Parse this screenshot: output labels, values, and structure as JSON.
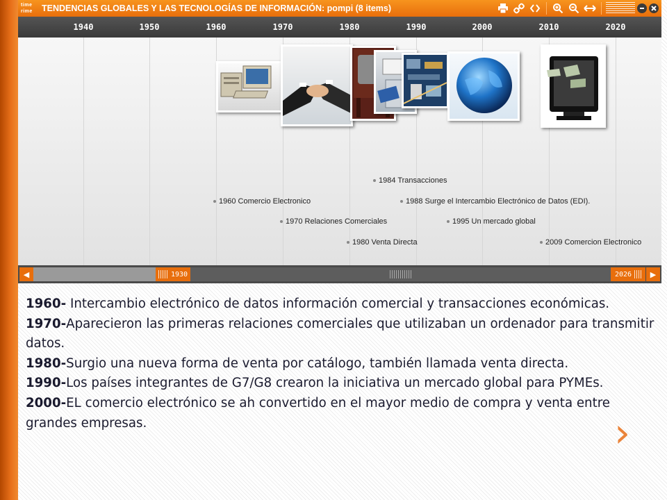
{
  "app": {
    "logo_top": "time",
    "logo_bottom": "rime",
    "title": "TENDENCIAS GLOBALES Y LAS TECNOLOGÍAS DE INFORMACIÓN: pompi  (8 items)",
    "toolbar_icons": [
      "print-icon",
      "link-icon",
      "embed-icon",
      "zoom-in-icon",
      "zoom-out-icon",
      "expand-icon",
      "menu-lines-icon",
      "minimize-icon",
      "close-icon"
    ],
    "accent_color": "#e86e0c"
  },
  "timeline": {
    "years": [
      "1940",
      "1950",
      "1960",
      "1970",
      "1980",
      "1990",
      "2000",
      "2010",
      "2020"
    ],
    "images": [
      {
        "name": "computer-photo",
        "subject": "desktop computer"
      },
      {
        "name": "handshake-photo",
        "subject": "business handshake"
      },
      {
        "name": "television-photo",
        "subject": "old television"
      },
      {
        "name": "card-payment-photo",
        "subject": "card payment"
      },
      {
        "name": "circuit-board-photo",
        "subject": "circuit board"
      },
      {
        "name": "globe-photo",
        "subject": "blue globe"
      },
      {
        "name": "monitor-money-photo",
        "subject": "monitor with money"
      }
    ],
    "events": [
      {
        "label": "1984 Transacciones"
      },
      {
        "label": "1960 Comercio Electronico"
      },
      {
        "label": "1988 Surge el  Intercambio Electrónico de Datos (EDI)."
      },
      {
        "label": "1970 Relaciones Comerciales"
      },
      {
        "label": "1995 Un mercado global"
      },
      {
        "label": "1980 Venta Directa"
      },
      {
        "label": "2009 Comercion Electronico"
      }
    ]
  },
  "scrollbar": {
    "start_label": "1930",
    "end_label": "2026"
  },
  "slide": {
    "paragraphs": [
      {
        "year": "1960-",
        "text": " Intercambio electrónico de datos información comercial y transacciones económicas."
      },
      {
        "year": "1970-",
        "text": "Aparecieron las primeras relaciones comerciales que utilizaban un ordenador  para transmitir datos."
      },
      {
        "year": "1980-",
        "text": "Surgio una nueva forma de venta por catálogo, también llamada venta directa."
      },
      {
        "year": "1990-",
        "text": "Los países integrantes de G7/G8 crearon la iniciativa un mercado global para PYMEs."
      },
      {
        "year": "2000-",
        "text": "EL comercio electrónico se ah convertido en el mayor medio de compra y venta entre grandes empresas."
      }
    ],
    "next_glyph": "›"
  }
}
